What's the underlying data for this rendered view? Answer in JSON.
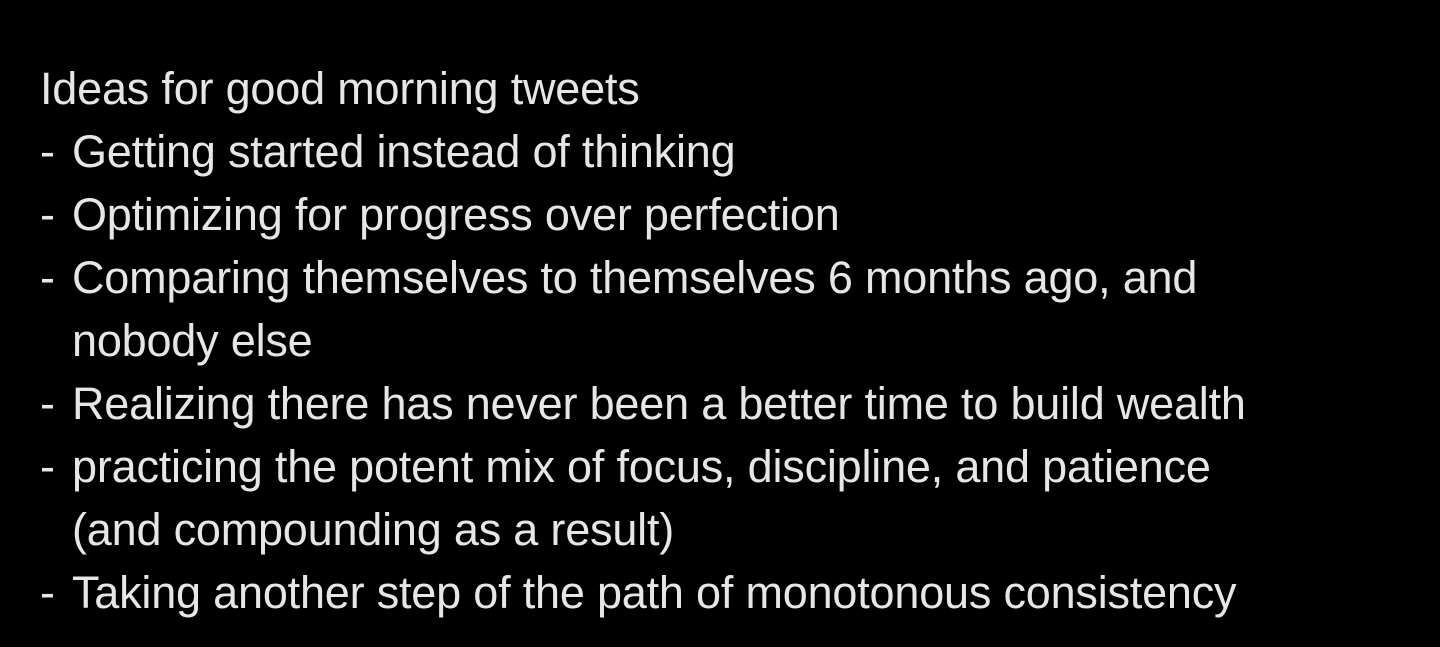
{
  "note": {
    "title": "Ideas for good morning tweets",
    "bullet": "-",
    "items": [
      {
        "lines": [
          "Getting started instead of thinking"
        ]
      },
      {
        "lines": [
          "Optimizing for progress over perfection"
        ]
      },
      {
        "lines": [
          "Comparing themselves to themselves 6 months ago, and",
          "nobody else"
        ]
      },
      {
        "lines": [
          "Realizing there has never been a better time to build wealth"
        ]
      },
      {
        "lines": [
          "practicing the potent mix of focus, discipline, and patience",
          "(and compounding as a result)"
        ]
      },
      {
        "lines": [
          "Taking another step of the path of monotonous consistency"
        ]
      }
    ]
  },
  "colors": {
    "background": "#000000",
    "text": "#e6e6e6"
  }
}
